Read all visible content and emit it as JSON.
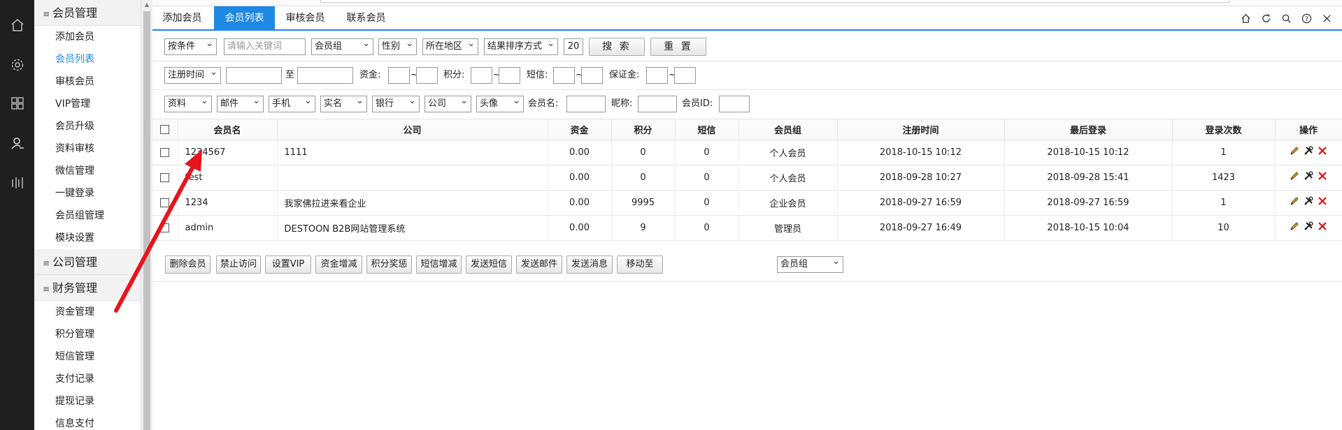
{
  "sidebar_groups": [
    {
      "label": "会员管理",
      "items": [
        "添加会员",
        "会员列表",
        "审核会员",
        "VIP管理",
        "会员升级",
        "资料审核",
        "微信管理",
        "一键登录",
        "会员组管理",
        "模块设置"
      ]
    },
    {
      "label": "公司管理",
      "items": []
    },
    {
      "label": "财务管理",
      "items": [
        "资金管理",
        "积分管理",
        "短信管理",
        "支付记录",
        "提现记录",
        "信息支付"
      ]
    }
  ],
  "tabs": [
    "添加会员",
    "会员列表",
    "审核会员",
    "联系会员"
  ],
  "active_tab": 1,
  "filters": {
    "row1": {
      "condition": "按条件",
      "keyword_placeholder": "请输入关键词",
      "group": "会员组",
      "gender": "性别",
      "region": "所在地区",
      "sort": "结果排序方式",
      "pagesize": "20",
      "search": "搜 索",
      "reset": "重 置"
    },
    "row2": {
      "time_field": "注册时间",
      "to": "至",
      "funds": "资金:",
      "tilde": "~",
      "points": "积分:",
      "sms": "短信:",
      "deposit": "保证金:"
    },
    "row3": {
      "profile": "资料",
      "email": "邮件",
      "phone": "手机",
      "realname": "实名",
      "bank": "银行",
      "company": "公司",
      "avatar": "头像",
      "username": "会员名:",
      "nickname": "昵称:",
      "userid": "会员ID:"
    }
  },
  "table": {
    "headers": [
      "会员名",
      "公司",
      "资金",
      "积分",
      "短信",
      "会员组",
      "注册时间",
      "最后登录",
      "登录次数",
      "操作"
    ],
    "rows": [
      [
        "1234567",
        "1111",
        "0.00",
        "0",
        "0",
        "个人会员",
        "2018-10-15 10:12",
        "2018-10-15 10:12",
        "1"
      ],
      [
        "test",
        "",
        "0.00",
        "0",
        "0",
        "个人会员",
        "2018-09-28 10:27",
        "2018-09-28 15:41",
        "1423"
      ],
      [
        "1234",
        "我家佛拉进来看企业",
        "0.00",
        "9995",
        "0",
        "企业会员",
        "2018-09-27 16:59",
        "2018-09-27 16:59",
        "1"
      ],
      [
        "admin",
        "DESTOON B2B网站管理系统",
        "0.00",
        "9",
        "0",
        "管理员",
        "2018-09-27 16:49",
        "2018-10-15 10:04",
        "10"
      ]
    ]
  },
  "actions": [
    "删除会员",
    "禁止访问",
    "设置VIP",
    "资金增减",
    "积分奖惩",
    "短信增减",
    "发送短信",
    "发送邮件",
    "发送消息",
    "移动至"
  ],
  "move_group": "会员组",
  "toolbar_icons": [
    "home-icon",
    "refresh-icon",
    "search-icon",
    "help-icon",
    "close-icon"
  ],
  "colors": {
    "accent": "#1e88e5",
    "dark_bar": "#1f1f1f",
    "arrow": "#e8131b"
  }
}
